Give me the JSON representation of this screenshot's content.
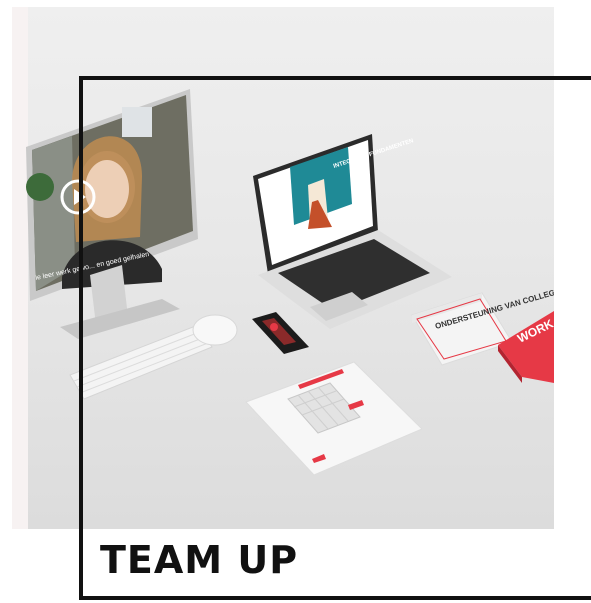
{
  "title": "TEAM UP",
  "scene": {
    "imac_caption": "ie leer werk gewo... en goed gelhalen",
    "laptop_headline": "INTEGRATIE FUNDAMENTEN",
    "book_title": "ONDERSTEUNING VAN COLLEGA'S",
    "red_box_text": "WORK"
  },
  "colors": {
    "frame": "#111111",
    "accent_red": "#e63946",
    "teal": "#1f8a96"
  }
}
